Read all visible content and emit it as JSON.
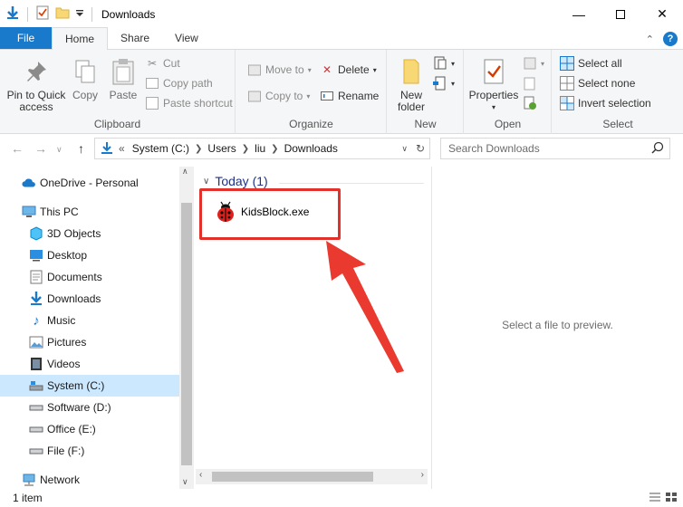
{
  "window": {
    "title": "Downloads"
  },
  "ribbon_tabs": [
    "File",
    "Home",
    "Share",
    "View"
  ],
  "clipboard": {
    "pin_label": "Pin to Quick access",
    "copy_label": "Copy",
    "paste_label": "Paste",
    "cut_label": "Cut",
    "copy_path_label": "Copy path",
    "paste_shortcut_label": "Paste shortcut",
    "group_label": "Clipboard"
  },
  "organize": {
    "move_to_label": "Move to",
    "copy_to_label": "Copy to",
    "delete_label": "Delete",
    "rename_label": "Rename",
    "group_label": "Organize"
  },
  "new": {
    "new_folder_label": "New folder",
    "group_label": "New"
  },
  "open": {
    "properties_label": "Properties",
    "group_label": "Open"
  },
  "select": {
    "select_all_label": "Select all",
    "select_none_label": "Select none",
    "invert_label": "Invert selection",
    "group_label": "Select"
  },
  "address": {
    "overflow": "«",
    "crumbs": [
      "System (C:)",
      "Users",
      "liu",
      "Downloads"
    ]
  },
  "search": {
    "placeholder": "Search Downloads"
  },
  "sidebar": {
    "items": [
      {
        "label": "OneDrive - Personal",
        "icon": "cloud-icon"
      },
      {
        "label": "This PC",
        "icon": "computer-icon"
      },
      {
        "label": "3D Objects",
        "icon": "cube-icon"
      },
      {
        "label": "Desktop",
        "icon": "desktop-icon"
      },
      {
        "label": "Documents",
        "icon": "document-icon"
      },
      {
        "label": "Downloads",
        "icon": "download-icon"
      },
      {
        "label": "Music",
        "icon": "music-icon"
      },
      {
        "label": "Pictures",
        "icon": "pictures-icon"
      },
      {
        "label": "Videos",
        "icon": "videos-icon"
      },
      {
        "label": "System (C:)",
        "icon": "drive-icon",
        "selected": true
      },
      {
        "label": "Software (D:)",
        "icon": "drive-icon"
      },
      {
        "label": "Office (E:)",
        "icon": "drive-icon"
      },
      {
        "label": "File (F:)",
        "icon": "drive-icon"
      },
      {
        "label": "Network",
        "icon": "network-icon"
      }
    ]
  },
  "content": {
    "group_header": "Today (1)",
    "files": [
      {
        "name": "KidsBlock.exe",
        "icon": "ladybug-icon"
      }
    ]
  },
  "preview": {
    "message": "Select a file to preview."
  },
  "status": {
    "count": "1 item"
  },
  "colors": {
    "accent": "#1979ca",
    "highlight": "#e2312b",
    "selected": "#cce8ff"
  }
}
